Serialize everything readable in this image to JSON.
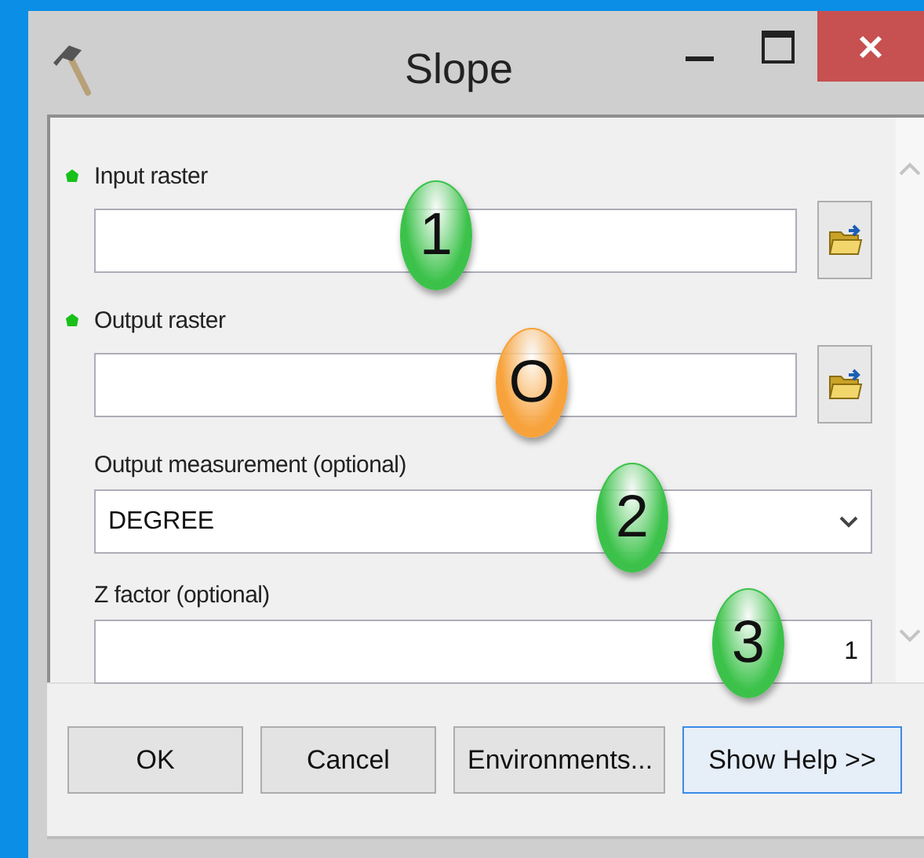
{
  "window": {
    "title": "Slope"
  },
  "parameters": [
    {
      "label": "Input raster",
      "required": true,
      "kind": "path"
    },
    {
      "label": "Output raster",
      "required": true,
      "kind": "path"
    },
    {
      "label": "Output measurement (optional)",
      "required": false,
      "kind": "dropdown",
      "value": "DEGREE"
    },
    {
      "label": "Z factor (optional)",
      "required": false,
      "kind": "number",
      "value": "1"
    }
  ],
  "buttons": [
    {
      "label": "OK",
      "focused": false
    },
    {
      "label": "Cancel",
      "focused": false
    },
    {
      "label": "Environments...",
      "focused": false
    },
    {
      "label": "Show Help >>",
      "focused": true
    }
  ],
  "callouts": [
    {
      "label": "1",
      "color": "#3cc24a"
    },
    {
      "label": "O",
      "color": "#f7a23a"
    },
    {
      "label": "2",
      "color": "#3cc24a"
    },
    {
      "label": "3",
      "color": "#3cc24a"
    }
  ]
}
